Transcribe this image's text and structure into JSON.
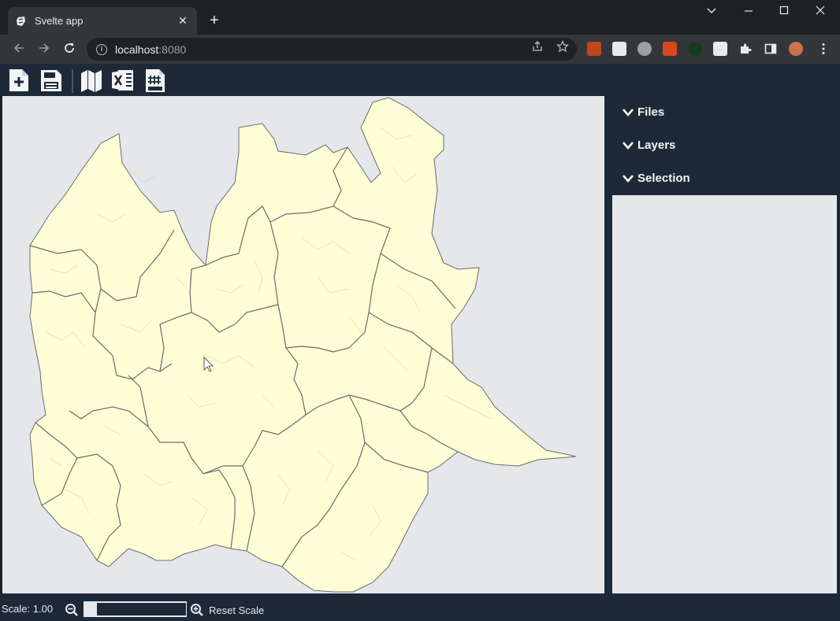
{
  "browser": {
    "tab_title": "Svelte app",
    "url_host": "localhost",
    "url_port": ":8080"
  },
  "app": {
    "tools": [
      "new-file",
      "save",
      "map",
      "excel",
      "csv"
    ],
    "panel": {
      "sections": [
        {
          "label": "Files"
        },
        {
          "label": "Layers"
        },
        {
          "label": "Selection"
        }
      ]
    },
    "status": {
      "scale_label": "Scale: 1.00",
      "reset_label": "Reset Scale"
    }
  },
  "colors": {
    "app_bg": "#1e2938",
    "map_bg": "#e5e7eb",
    "region_fill": "#fefed6",
    "region_stroke": "#6b6b6b"
  }
}
